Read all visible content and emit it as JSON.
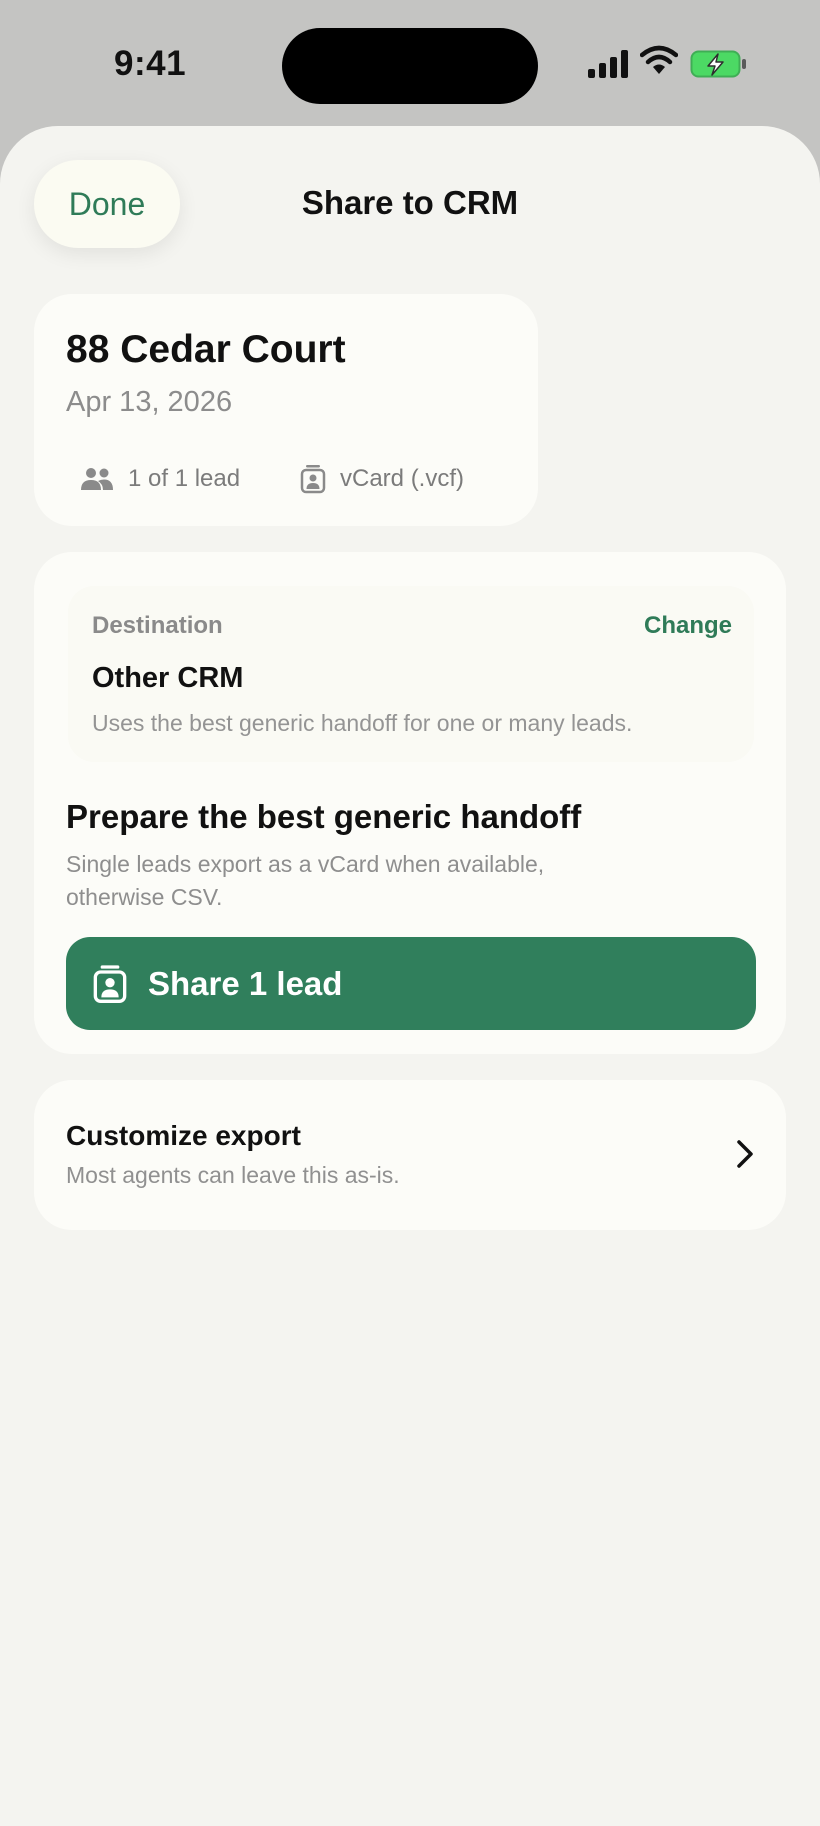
{
  "status_bar": {
    "time": "9:41"
  },
  "header": {
    "done_label": "Done",
    "title": "Share to CRM"
  },
  "summary": {
    "address": "88 Cedar Court",
    "date": "Apr 13, 2026",
    "lead_count": "1 of 1 lead",
    "format": "vCard (.vcf)"
  },
  "destination": {
    "label": "Destination",
    "change_label": "Change",
    "name": "Other CRM",
    "description": "Uses the best generic handoff for one or many leads."
  },
  "handoff": {
    "title": "Prepare the best generic handoff",
    "description": "Single leads export as a vCard when available, otherwise CSV.",
    "share_label": "Share 1 lead"
  },
  "customize": {
    "title": "Customize export",
    "description": "Most agents can leave this as-is."
  },
  "colors": {
    "accent": "#307f5c",
    "accent_text": "#2f7b58",
    "sheet": "#f4f4f0",
    "card": "#fcfcf8"
  },
  "icons": [
    "signal-icon",
    "wifi-icon",
    "battery-charging-icon",
    "people-icon",
    "contact-card-icon",
    "chevron-right-icon"
  ]
}
